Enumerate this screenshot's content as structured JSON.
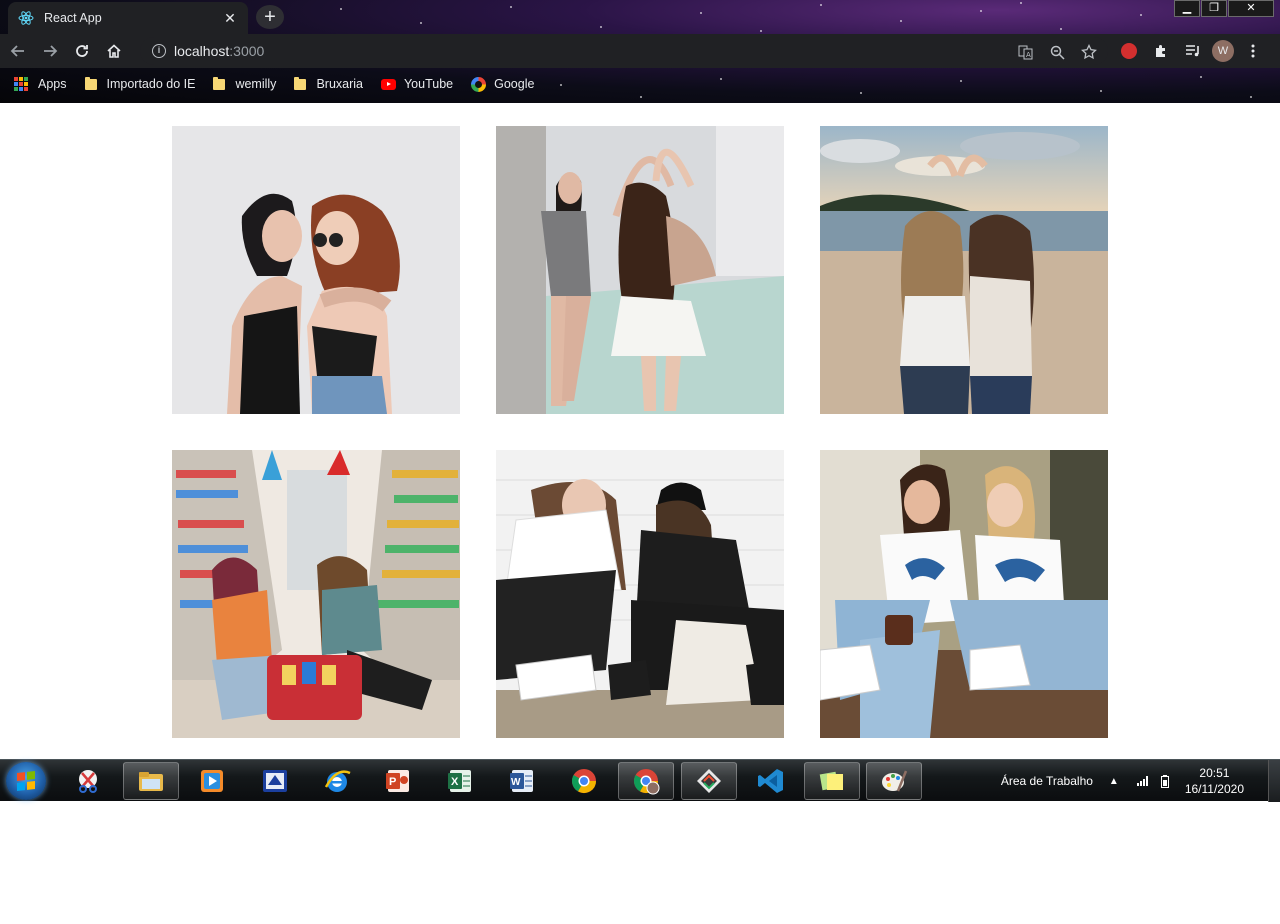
{
  "browser": {
    "tab": {
      "title": "React App",
      "favicon": "react-icon"
    },
    "window_controls": [
      "minimize",
      "restore",
      "close"
    ],
    "address": {
      "host": "localhost",
      "port": ":3000"
    },
    "bookmarks": [
      {
        "label": "Apps",
        "icon": "apps-grid-icon"
      },
      {
        "label": "Importado do IE",
        "icon": "folder-icon"
      },
      {
        "label": "wemilly",
        "icon": "folder-icon"
      },
      {
        "label": "Bruxaria",
        "icon": "folder-icon"
      },
      {
        "label": "YouTube",
        "icon": "youtube-icon"
      },
      {
        "label": "Google",
        "icon": "google-icon"
      }
    ],
    "profile_initial": "W"
  },
  "gallery": {
    "photos": [
      {
        "name": "photo-two-friends-hugging"
      },
      {
        "name": "photo-friends-heart-arms-wall"
      },
      {
        "name": "photo-friends-heart-beach"
      },
      {
        "name": "photo-friends-supermarket"
      },
      {
        "name": "photo-friends-sitting-wall"
      },
      {
        "name": "photo-friends-levis-shirts"
      }
    ]
  },
  "taskbar": {
    "apps": [
      "snipping-tool",
      "file-explorer",
      "media-player",
      "virtualbox",
      "internet-explorer",
      "powerpoint",
      "excel",
      "word",
      "chrome",
      "chrome-profile",
      "git-kraken",
      "vscode",
      "sticky-notes",
      "paint"
    ],
    "desktop_label": "Área de Trabalho",
    "time": "20:51",
    "date": "16/11/2020"
  },
  "colors": {
    "chrome_bg": "#202124",
    "page_bg": "#ffffff",
    "taskbar_bg": "#0b0d0f"
  }
}
